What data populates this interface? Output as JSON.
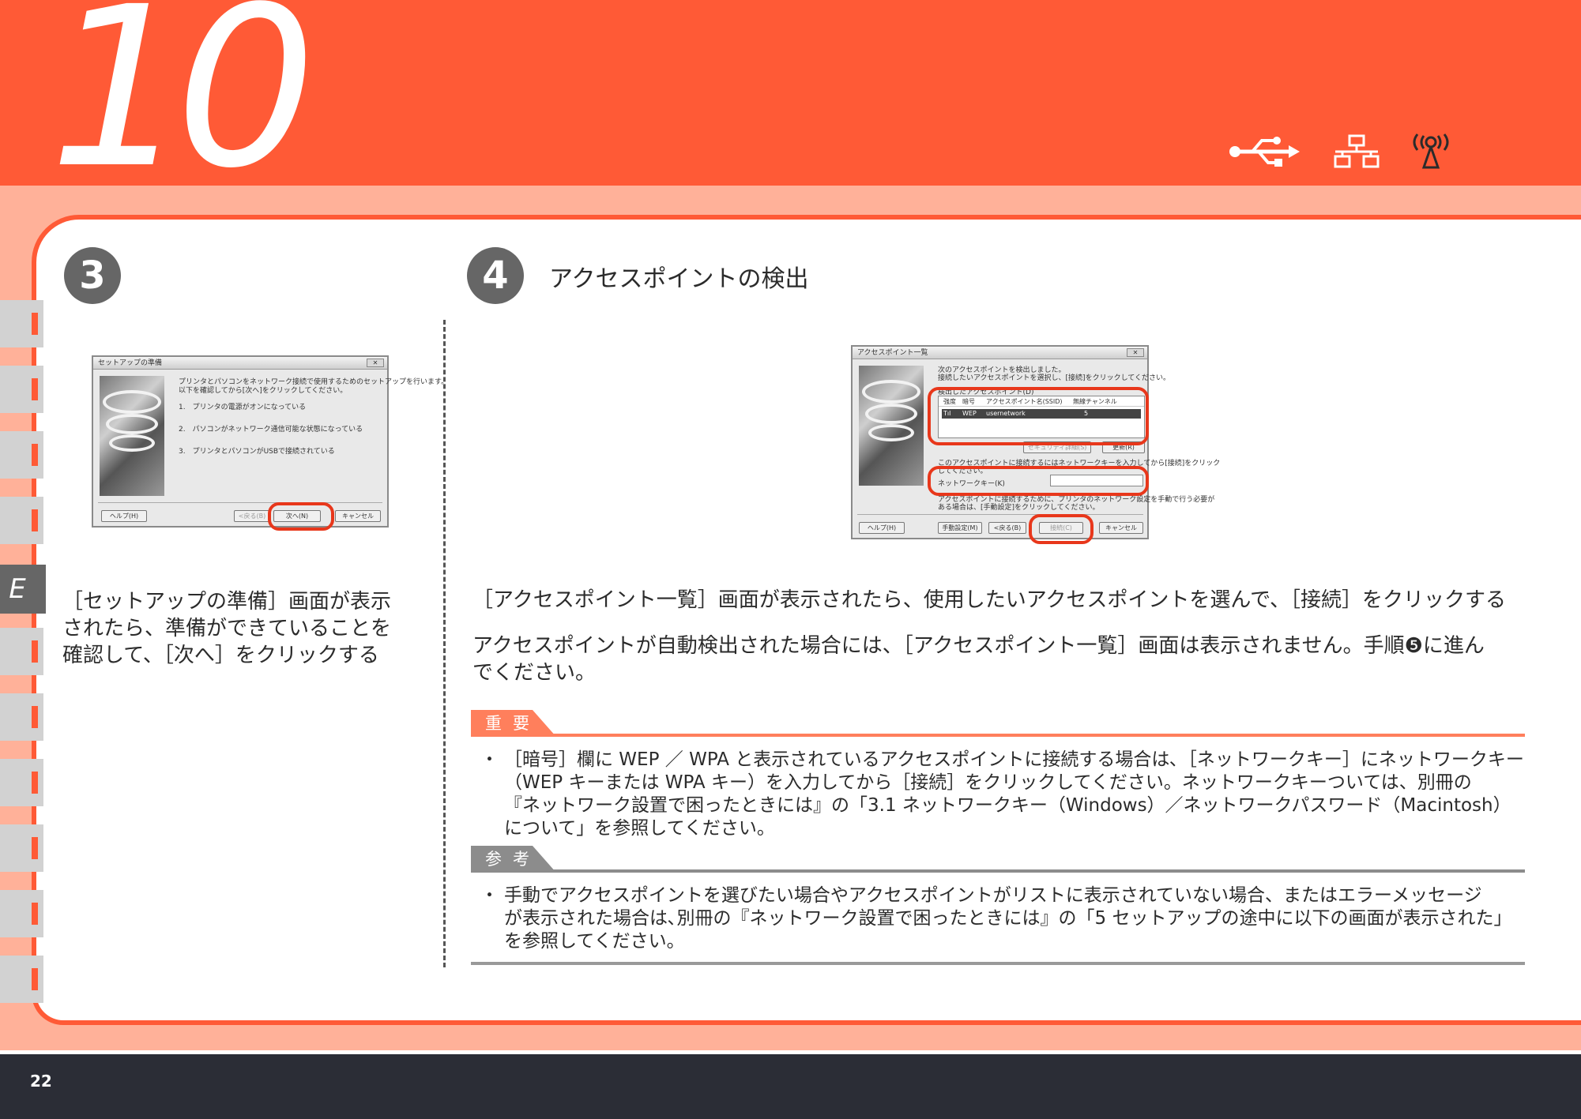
{
  "header": {
    "chapter_number": "10",
    "connection_icons": [
      "usb-icon",
      "wired-lan-icon",
      "wireless-lan-icon"
    ],
    "accent_color": "#ff5a36"
  },
  "sidebar": {
    "section_letter": "E"
  },
  "step3": {
    "number": "3",
    "dialog": {
      "title": "セットアップの準備",
      "intro_line1": "プリンタとパソコンをネットワーク接続で使用するためのセットアップを行います。",
      "intro_line2": "以下を確認してから[次へ]をクリックしてください。",
      "items": [
        "1.　プリンタの電源がオンになっている",
        "2.　パソコンがネットワーク通信可能な状態になっている",
        "3.　プリンタとパソコンがUSBで接続されている"
      ],
      "help_button": "ヘルプ(H)",
      "back_button": "<戻る(B)",
      "next_button": "次へ(N)",
      "cancel_button": "キャンセル",
      "close": "✕"
    },
    "instruction": [
      "［セットアップの準備］画面が表示",
      "されたら、準備ができていることを",
      "確認して、［次へ］をクリックする"
    ]
  },
  "step4": {
    "number": "4",
    "title": "アクセスポイントの検出",
    "dialog": {
      "title": "アクセスポイント一覧",
      "intro_line1": "次のアクセスポイントを検出しました。",
      "intro_line2": "接続したいアクセスポイントを選択し、[接続]をクリックしてください。",
      "list_caption": "検出したアクセスポイント(D)",
      "columns": [
        "強度",
        "暗号",
        "アクセスポイント名(SSID)",
        "無線チャンネル"
      ],
      "row": {
        "strength": "Tıl",
        "encryption": "WEP",
        "ssid": "usernetwork",
        "channel": "5"
      },
      "detail_button": "セキュリティ詳細(S)",
      "refresh_button": "更新(R)",
      "key_hint_line1": "このアクセスポイントに接続するにはネットワークキーを入力してから[接続]をクリック",
      "key_hint_line2": "してください。",
      "key_label": "ネットワークキー(K)",
      "note_line1": "アクセスポイントに接続するために、プリンタのネットワーク設定を手動で行う必要が",
      "note_line2": "ある場合は、[手動設定]をクリックしてください。",
      "help_button": "ヘルプ(H)",
      "manual_button": "手動設定(M)",
      "back_button": "<戻る(B)",
      "connect_button": "接続(C)",
      "cancel_button": "キャンセル",
      "close": "✕"
    },
    "instruction": "［アクセスポイント一覧］画面が表示されたら、使用したいアクセスポイントを選んで、［接続］をクリックする",
    "auto_note_line1": "アクセスポイントが自動検出された場合には、［アクセスポイント一覧］画面は表示されません。手順❺に進ん",
    "auto_note_line2": "でください。"
  },
  "important": {
    "label": "重要",
    "bullet": "・",
    "lines": [
      "［暗号］欄に WEP ／ WPA と表示されているアクセスポイントに接続する場合は､［ネットワークキー］にネットワークキー",
      "（WEP キーまたは WPA キー）を入力してから［接続］をクリックしてください。ネットワークキーついては、別冊の",
      "『ネットワーク設置で困ったときには』の「3.1 ネットワークキー（Windows）／ネットワークパスワード（Macintosh）",
      "について」を参照してください。"
    ],
    "color": "#ff7f5c"
  },
  "reference": {
    "label": "参考",
    "bullet": "・",
    "lines": [
      "手動でアクセスポイントを選びたい場合やアクセスポイントがリストに表示されていない場合、またはエラーメッセージ",
      "が表示された場合は､別冊の『ネットワーク設置で困ったときには』の「5 セットアップの途中に以下の画面が表示された」",
      "を参照してください。"
    ],
    "color": "#8c8c8c"
  },
  "footer": {
    "page_number": "22"
  }
}
